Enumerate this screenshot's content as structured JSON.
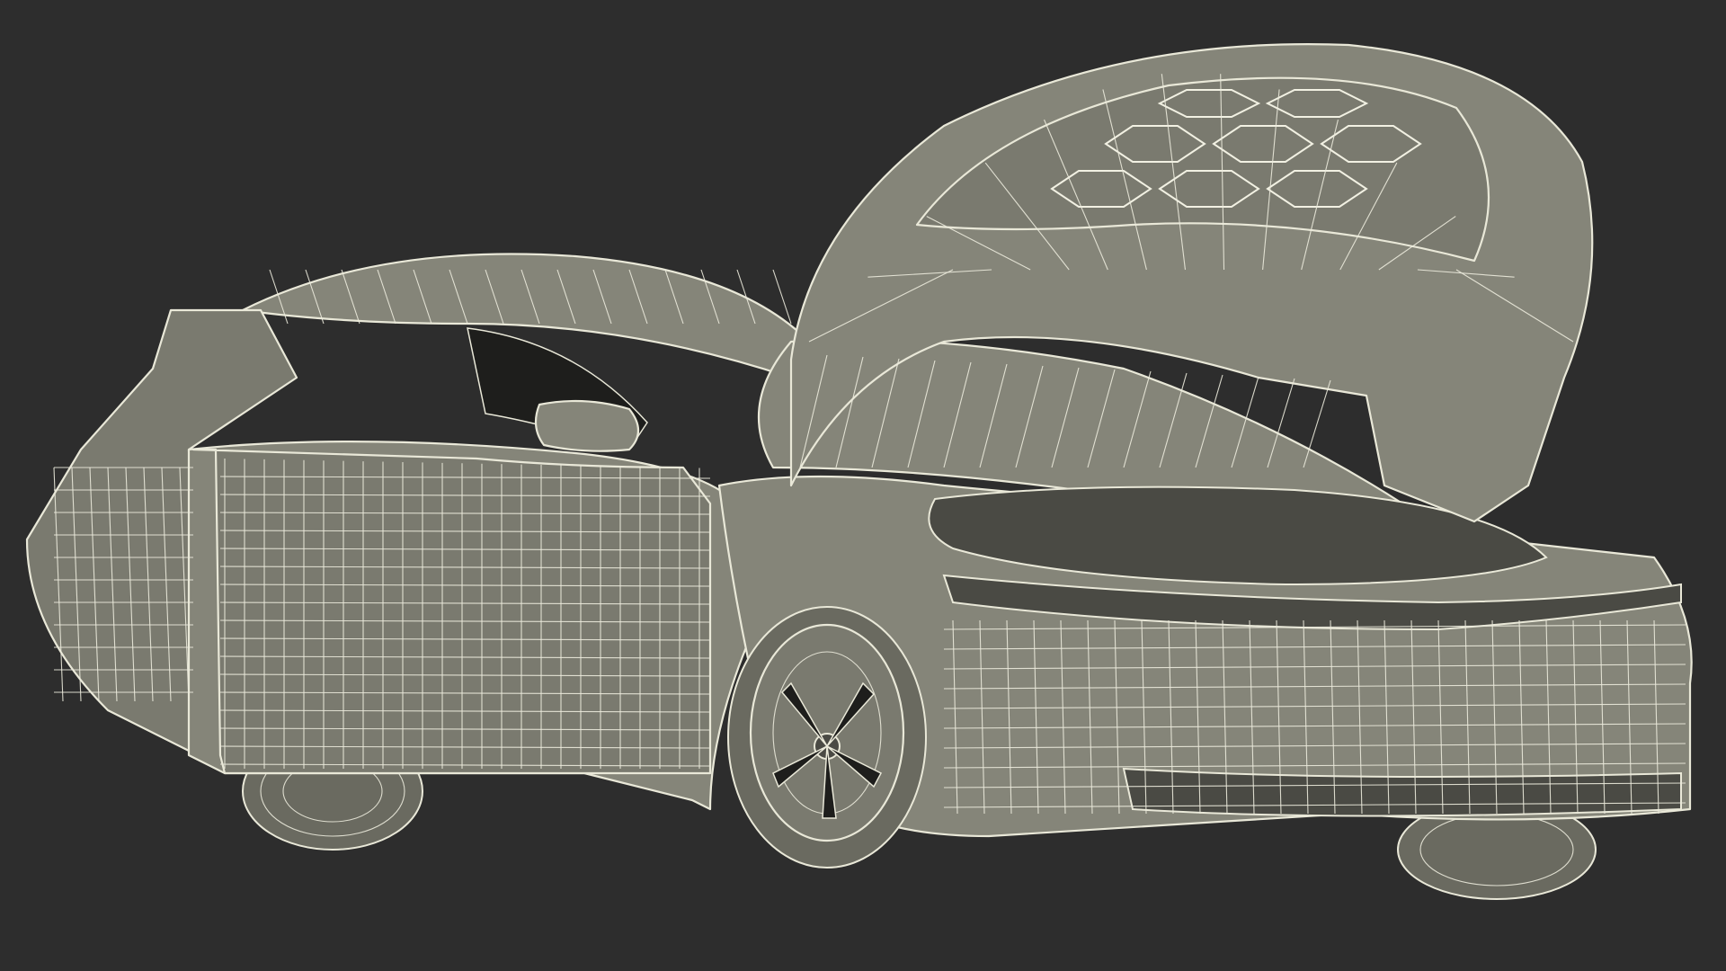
{
  "scene": {
    "background_color": "#2d2d2d",
    "surface_color": "#858579",
    "wire_color": "#ebeadb"
  }
}
